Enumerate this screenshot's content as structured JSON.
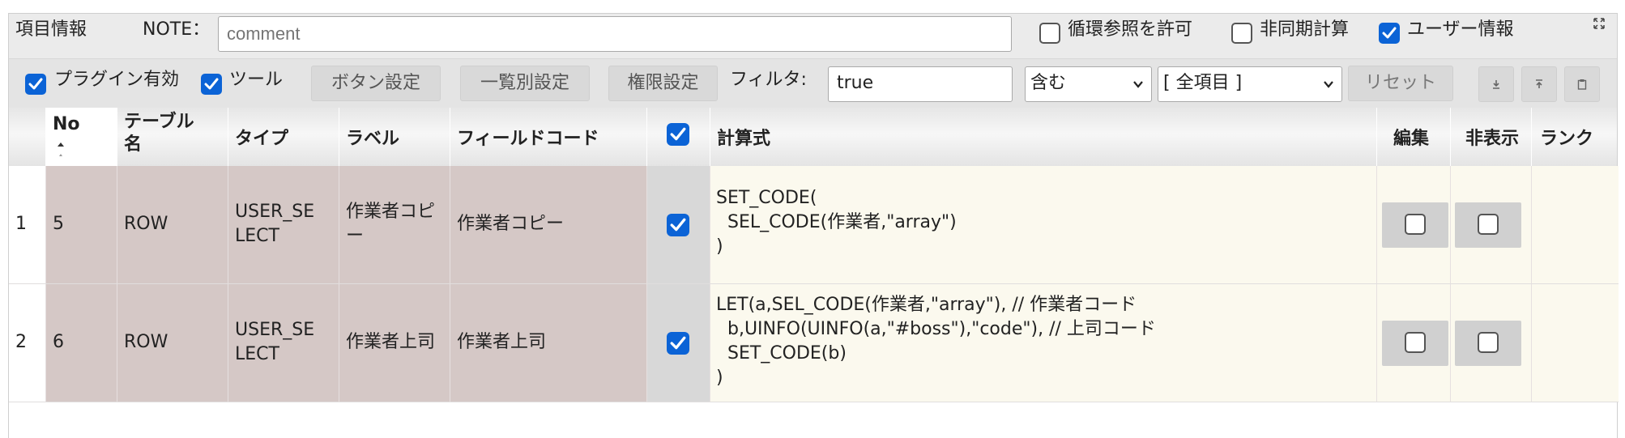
{
  "toolbar": {
    "item_info_label": "項目情報",
    "note_label": "NOTE：",
    "note_placeholder": "comment",
    "allow_circular_label": "循環参照を許可",
    "async_calc_label": "非同期計算",
    "user_info_label": "ユーザー情報",
    "allow_circular_checked": false,
    "async_calc_checked": false,
    "user_info_checked": true,
    "plugin_enabled_label": "プラグイン有効",
    "tools_label": "ツール",
    "plugin_enabled_checked": true,
    "tools_checked": true,
    "button_settings_label": "ボタン設定",
    "list_settings_label": "一覧別設定",
    "permission_settings_label": "権限設定",
    "filter_label": "フィルタ:",
    "filter_value": "true",
    "match_select_value": "含む",
    "field_select_value": "[ 全項目 ]",
    "reset_label": "リセット"
  },
  "icons": {
    "expand": "expand-icon",
    "download": "download-icon",
    "upload": "upload-icon",
    "clipboard": "clipboard-icon",
    "checkmark": "checkmark-icon"
  },
  "table": {
    "headers": {
      "no": "No",
      "table_name_1": "テーブル",
      "table_name_2": "名",
      "type": "タイプ",
      "label": "ラベル",
      "field_code": "フィールドコード",
      "formula": "計算式",
      "edit": "編集",
      "hidden": "非表示",
      "rank": "ランク"
    },
    "rows": [
      {
        "index": "1",
        "no": "5",
        "table_name": "ROW",
        "type_1": "USER_SE",
        "type_2": "LECT",
        "label_1": "作業者コピ",
        "label_2": "ー",
        "field_code": "作業者コピー",
        "checked": true,
        "formula_lines": [
          "SET_CODE(",
          "  SEL_CODE(作業者,\"array\")",
          ")"
        ],
        "edit_checked": false,
        "hidden_checked": false
      },
      {
        "index": "2",
        "no": "6",
        "table_name": "ROW",
        "type_1": "USER_SE",
        "type_2": "LECT",
        "label_1": "作業者上司",
        "label_2": "",
        "field_code": "作業者上司",
        "checked": true,
        "formula_lines": [
          "LET(a,SEL_CODE(作業者,\"array\"), // 作業者コード",
          "  b,UINFO(UINFO(a,\"#boss\"),\"code\"), // 上司コード",
          "  SET_CODE(b)",
          ")"
        ],
        "edit_checked": false,
        "hidden_checked": false
      }
    ]
  },
  "colors": {
    "checkbox_blue": "#0b63d6",
    "row_mauve": "#d5c8c6",
    "formula_cream": "#fbf9ee"
  }
}
